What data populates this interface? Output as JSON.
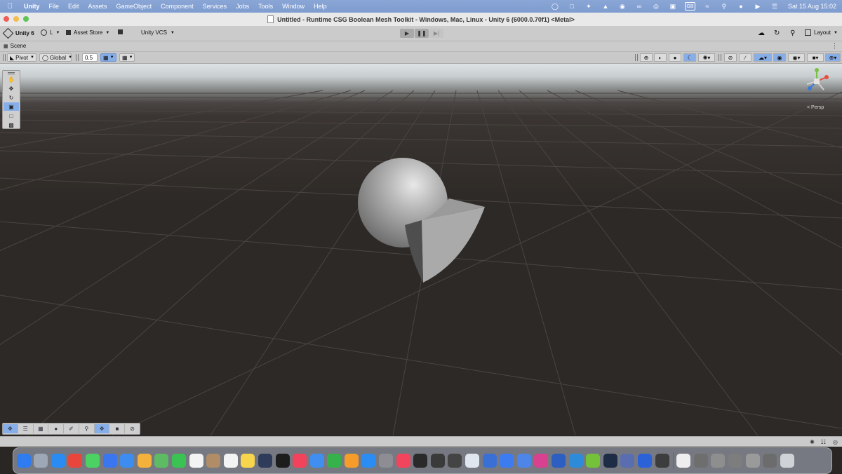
{
  "menubar": {
    "apple_icon": "apple-icon",
    "app_name": "Unity",
    "items": [
      "File",
      "Edit",
      "Assets",
      "GameObject",
      "Component",
      "Services",
      "Jobs",
      "Tools",
      "Window",
      "Help"
    ],
    "status_icons": [
      "zoom-icon",
      "screen-mirror-icon",
      "sparkle-icon",
      "pen-icon",
      "record-icon",
      "creative-cloud-icon",
      "vpn-icon",
      "display-icon",
      "wifi-icon",
      "search-icon",
      "siri-icon",
      "play-icon",
      "control-center-icon"
    ],
    "keyboard_label": "GB",
    "clock": "Sat 15 Aug  15:02"
  },
  "window": {
    "title": "Untitled - Runtime CSG Boolean Mesh Toolkit - Windows, Mac, Linux - Unity 6 (6000.0.70f1) <Metal>"
  },
  "toolbar": {
    "unity_label": "Unity 6",
    "account_label": "L",
    "asset_store_label": "Asset Store",
    "vcs_label": "Unity VCS",
    "layout_label": "Layout"
  },
  "scene": {
    "tab_label": "Scene",
    "pivot_label": "Pivot",
    "global_label": "Global",
    "snap_value": "0.5",
    "persp_label": "< Persp"
  },
  "colors": {
    "menubar": "#7e9ccf",
    "selected": "#86aee9",
    "viewport_ground": "#2d2926",
    "grid_line": "#4a4542",
    "mesh_light": "#b9b9b9",
    "mesh_dark": "#6d6d6d"
  },
  "dock": {
    "apps": [
      {
        "name": "finder-icon",
        "color": "#2f7cf0"
      },
      {
        "name": "launchpad-icon",
        "color": "#9ea7b5"
      },
      {
        "name": "safari-icon",
        "color": "#2a8cf3"
      },
      {
        "name": "chrome-icon",
        "color": "#e8453c"
      },
      {
        "name": "messages-icon",
        "color": "#4cd263"
      },
      {
        "name": "signal-icon",
        "color": "#3a76f0"
      },
      {
        "name": "mail-icon",
        "color": "#3d8cf0"
      },
      {
        "name": "photos-icon",
        "color": "#f4b13c"
      },
      {
        "name": "maps-icon",
        "color": "#5dbb63"
      },
      {
        "name": "facetime-icon",
        "color": "#3ac253"
      },
      {
        "name": "calendar-icon",
        "color": "#f3f3f3"
      },
      {
        "name": "contacts-icon",
        "color": "#b08d66"
      },
      {
        "name": "reminders-icon",
        "color": "#f3f3f3"
      },
      {
        "name": "notes-icon",
        "color": "#f7d54c"
      },
      {
        "name": "freeform-icon",
        "color": "#2e3c5a"
      },
      {
        "name": "tv-icon",
        "color": "#1d1d1d"
      },
      {
        "name": "music-icon",
        "color": "#f3425b"
      },
      {
        "name": "keynote-icon",
        "color": "#3f8ef0"
      },
      {
        "name": "numbers-icon",
        "color": "#36b24a"
      },
      {
        "name": "pages-icon",
        "color": "#f59c2a"
      },
      {
        "name": "app-store-icon",
        "color": "#2b8cf3"
      },
      {
        "name": "system-settings-icon",
        "color": "#8d8d93"
      },
      {
        "name": "news-icon",
        "color": "#f3445d"
      },
      {
        "name": "terminal-icon",
        "color": "#2a2a2a"
      },
      {
        "name": "chatgpt-icon",
        "color": "#3a3a3a"
      },
      {
        "name": "openai-icon",
        "color": "#444444"
      },
      {
        "name": "testflight-icon",
        "color": "#dfe6ef"
      },
      {
        "name": "xcode-icon",
        "color": "#3a6fd6"
      },
      {
        "name": "spark-icon",
        "color": "#3d7cf0"
      },
      {
        "name": "preview-icon",
        "color": "#4d86e8"
      },
      {
        "name": "shortcuts-icon",
        "color": "#d8418f"
      },
      {
        "name": "tablet-icon",
        "color": "#2d5fc2"
      },
      {
        "name": "qbittorrent-icon",
        "color": "#2e8bd9"
      },
      {
        "name": "android-studio-icon",
        "color": "#73c23a"
      },
      {
        "name": "wacom-icon",
        "color": "#1f2c46"
      },
      {
        "name": "vr-icon",
        "color": "#5a6db0"
      },
      {
        "name": "unity-hub-icon",
        "color": "#2b62d8"
      },
      {
        "name": "unity-icon",
        "color": "#3d3d3d"
      }
    ],
    "recents": [
      {
        "name": "document-icon",
        "color": "#eeeeee"
      },
      {
        "name": "folder-icon",
        "color": "#6e6e6e"
      },
      {
        "name": "screenshot-icon",
        "color": "#8e8e8e"
      },
      {
        "name": "screenshot-icon",
        "color": "#7d7d7d"
      },
      {
        "name": "screenshot-icon",
        "color": "#9a9a9a"
      },
      {
        "name": "screenshot-icon",
        "color": "#6c6c6c"
      },
      {
        "name": "trash-icon",
        "color": "#cfd3d8"
      }
    ]
  }
}
